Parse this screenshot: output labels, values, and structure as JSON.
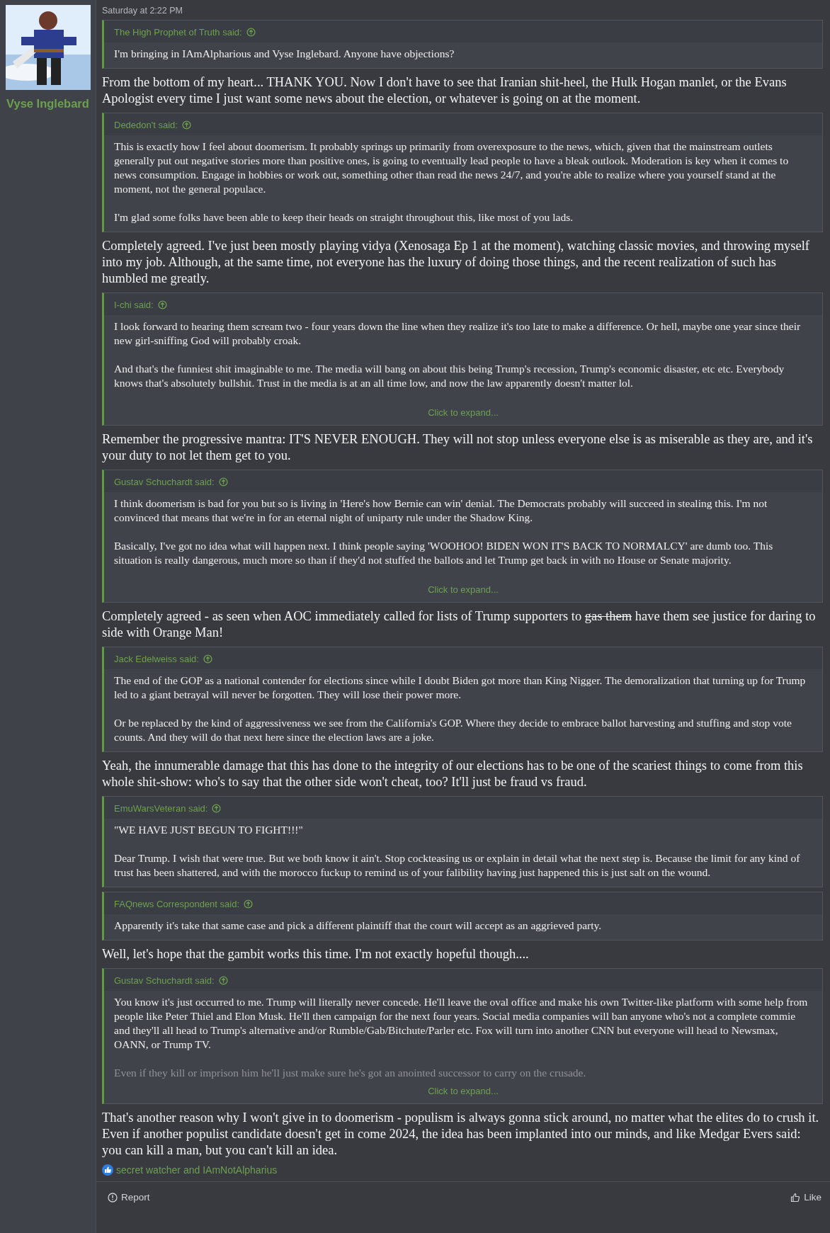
{
  "author": {
    "name": "Vyse Inglebard"
  },
  "post": {
    "date": "Saturday at 2:22 PM",
    "blocks": [
      {
        "kind": "quote",
        "said": "The High Prophet of Truth said:",
        "paragraphs": [
          {
            "text": "I'm bringing in IAmAlpharious and Vyse Inglebard. Anyone have objections?",
            "faded": false
          }
        ]
      },
      {
        "kind": "text",
        "segments": [
          {
            "text": "From the bottom of my heart... THANK YOU. Now I don't have to see that Iranian shit-heel, the Hulk Hogan manlet, or the Evans Apologist every time I just want some news about the election, or whatever is going on at the moment.",
            "struck": false
          }
        ]
      },
      {
        "kind": "quote",
        "said": "Dededon't said:",
        "paragraphs": [
          {
            "text": "This is exactly how I feel about doomerism. It probably springs up primarily from overexposure to the news, which, given that the mainstream outlets generally put out negative stories more than positive ones, is going to eventually lead people to have a bleak outlook. Moderation is key when it comes to news consumption. Engage in hobbies or work out, something other than read the news 24/7, and you're able to realize where you yourself stand at the moment, not the general populace.",
            "faded": false
          },
          {
            "text": "I'm glad some folks have been able to keep their heads on straight throughout this, like most of you lads.",
            "faded": false
          }
        ]
      },
      {
        "kind": "text",
        "segments": [
          {
            "text": "Completely agreed. I've just been mostly playing vidya (Xenosaga Ep 1 at the moment), watching classic movies, and throwing myself into my job. Although, at the same time, not everyone has the luxury of doing those things, and the recent realization of such has humbled me greatly.",
            "struck": false
          }
        ]
      },
      {
        "kind": "quote",
        "said": "I-chi said:",
        "paragraphs": [
          {
            "text": "I look forward to hearing them scream two - four years down the line when they realize it's too late to make a difference. Or hell, maybe one year since their new girl-sniffing God will probably croak.",
            "faded": false
          },
          {
            "text": "And that's the funniest shit imaginable to me. The media will bang on about this being Trump's recession, Trump's economic disaster, etc etc. Everybody knows that's absolutely bullshit. Trust in the media is at an all time low, and now the law apparently doesn't matter lol.",
            "faded": false
          }
        ],
        "expand": "Click to expand..."
      },
      {
        "kind": "text",
        "segments": [
          {
            "text": "Remember the progressive mantra: IT'S NEVER ENOUGH. They will not stop unless everyone else is as miserable as they are, and it's your duty to not let them get to you.",
            "struck": false
          }
        ]
      },
      {
        "kind": "quote",
        "said": "Gustav Schuchardt said:",
        "paragraphs": [
          {
            "text": "I think doomerism is bad for you but so is living in 'Here's how Bernie can win' denial. The Democrats probably will succeed in stealing this. I'm not convinced that means that we're in for an eternal night of uniparty rule under the Shadow King.",
            "faded": false
          },
          {
            "text": "Basically, I've got no idea what will happen next. I think people saying 'WOOHOO! BIDEN WON IT'S BACK TO NORMALCY' are dumb too. This situation is really dangerous, much more so than if they'd not stuffed the ballots and let Trump get back in with no House or Senate majority.",
            "faded": false
          }
        ],
        "expand": "Click to expand..."
      },
      {
        "kind": "text",
        "segments": [
          {
            "text": "Completely agreed - as seen when AOC immediately called for lists of Trump supporters to",
            "struck": false
          },
          {
            "text": "gas them",
            "struck": true
          },
          {
            "text": "have them see justice for daring to side with Orange Man!",
            "struck": false
          }
        ]
      },
      {
        "kind": "quote",
        "said": "Jack Edelweiss said:",
        "paragraphs": [
          {
            "text": "The end of the GOP as a national contender for elections since while I doubt Biden got more than King Nigger. The demoralization that turning up for Trump led to a giant betrayal will never be forgotten. They will lose their power more.",
            "faded": false
          },
          {
            "text": "Or be replaced by the kind of aggressiveness we see from the California's GOP. Where they decide to embrace ballot harvesting and stuffing and stop vote counts. And they will do that next here since the election laws are a joke.",
            "faded": false
          }
        ]
      },
      {
        "kind": "text",
        "segments": [
          {
            "text": "Yeah, the innumerable damage that this has done to the integrity of our elections has to be one of the scariest things to come from this whole shit-show: who's to say that the other side won't cheat, too? It'll just be fraud vs fraud.",
            "struck": false
          }
        ]
      },
      {
        "kind": "quote",
        "said": "EmuWarsVeteran said:",
        "paragraphs": [
          {
            "text": "\"WE HAVE JUST BEGUN TO FIGHT!!!\"",
            "faded": false
          },
          {
            "text": "Dear Trump. I wish that were true. But we both know it ain't. Stop cockteasing us or explain in detail what the next step is. Because the limit for any kind of trust has been shattered, and with the morocco fuckup to remind us of your falibility having just happened this is just salt on the wound.",
            "faded": false
          }
        ]
      },
      {
        "kind": "quote",
        "said": "FAQnews Correspondent said:",
        "paragraphs": [
          {
            "text": "Apparently it's take that same case and pick a different plaintiff that the court will accept as an aggrieved party.",
            "faded": false
          }
        ]
      },
      {
        "kind": "text",
        "segments": [
          {
            "text": "Well, let's hope that the gambit works this time. I'm not exactly hopeful though....",
            "struck": false
          }
        ]
      },
      {
        "kind": "quote",
        "said": "Gustav Schuchardt said:",
        "paragraphs": [
          {
            "text": "You know it's just occurred to me. Trump will literally never concede. He'll leave the oval office and make his own Twitter-like platform with some help from people like Peter Thiel and Elon Musk. He'll then campaign for the next four years. Social media companies will ban anyone who's not a complete commie and they'll all head to Trump's alternative and/or Rumble/Gab/Bitchute/Parler etc. Fox will turn into another CNN but everyone will head to Newsmax, OANN, or Trump TV.",
            "faded": false
          },
          {
            "text": "Even if they kill or imprison him he'll just make sure he's got an anointed successor to carry on the crusade.",
            "faded": true
          }
        ],
        "expand": "Click to expand..."
      },
      {
        "kind": "text",
        "segments": [
          {
            "text": "That's another reason why I won't give in to doomerism - populism is always gonna stick around, no matter what the elites do to crush it. Even if another populist candidate doesn't get in come 2024, the idea has been implanted into our minds, and like Medgar Evers said: you can kill a man, but you can't kill an idea.",
            "struck": false
          }
        ]
      }
    ],
    "reactions": "secret watcher and IAmNotAlpharius",
    "actions": {
      "report": "Report",
      "like": "Like"
    }
  }
}
